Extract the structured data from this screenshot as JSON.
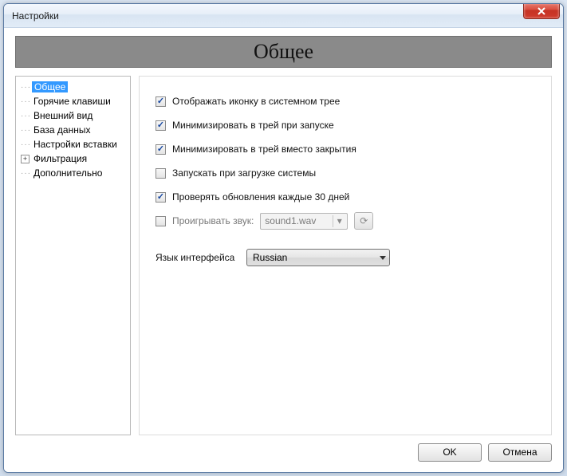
{
  "window": {
    "title": "Настройки"
  },
  "header": {
    "title": "Общее"
  },
  "tree": {
    "items": [
      {
        "label": "Общее",
        "selected": true,
        "expander": false
      },
      {
        "label": "Горячие клавиши",
        "selected": false,
        "expander": false
      },
      {
        "label": "Внешний вид",
        "selected": false,
        "expander": false
      },
      {
        "label": "База данных",
        "selected": false,
        "expander": false
      },
      {
        "label": "Настройки вставки",
        "selected": false,
        "expander": false
      },
      {
        "label": "Фильтрация",
        "selected": false,
        "expander": true
      },
      {
        "label": "Дополнительно",
        "selected": false,
        "expander": false
      }
    ]
  },
  "options": {
    "show_tray_icon": {
      "label": "Отображать иконку в системном трее",
      "checked": true
    },
    "minimize_on_start": {
      "label": "Минимизировать в трей при запуске",
      "checked": true
    },
    "minimize_on_close": {
      "label": "Минимизировать в трей вместо закрытия",
      "checked": true
    },
    "run_at_startup": {
      "label": "Запускать при загрузке системы",
      "checked": false
    },
    "check_updates": {
      "label": "Проверять обновления каждые 30 дней",
      "checked": true
    },
    "play_sound": {
      "label": "Проигрывать звук:",
      "checked": false,
      "file": "sound1.wav"
    }
  },
  "language": {
    "label": "Язык интерфейса",
    "value": "Russian"
  },
  "buttons": {
    "ok": "OK",
    "cancel": "Отмена"
  }
}
